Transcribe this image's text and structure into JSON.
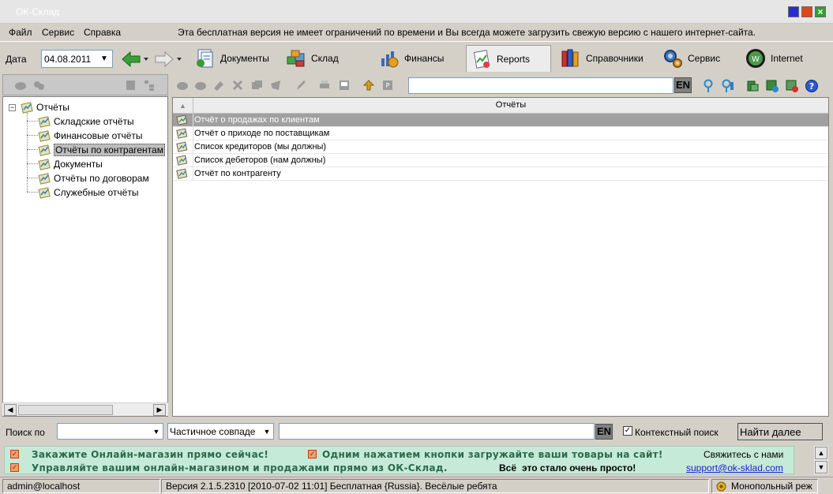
{
  "window": {
    "title": "ОК-Склад"
  },
  "menu": {
    "items": [
      "Файл",
      "Сервис",
      "Справка"
    ],
    "promo": "Эта бесплатная версия не имеет ограничений по времени и Вы всегда можете загрузить свежую версию с нашего интернет-сайта."
  },
  "nav": {
    "date_label": "Дата",
    "date_value": "04.08.2011",
    "tabs": [
      {
        "label": "Документы",
        "icon": "documents-icon"
      },
      {
        "label": "Склад",
        "icon": "warehouse-icon"
      },
      {
        "label": "Финансы",
        "icon": "finance-icon"
      },
      {
        "label": "Reports",
        "icon": "reports-icon"
      },
      {
        "label": "Справочники",
        "icon": "references-icon"
      },
      {
        "label": "Сервис",
        "icon": "service-icon"
      },
      {
        "label": "Internet",
        "icon": "internet-icon"
      }
    ]
  },
  "tree": {
    "root": "Отчёты",
    "children": [
      "Складские отчёты",
      "Финансовые отчёты",
      "Отчёты по контрагентам",
      "Документы",
      "Отчёты по договорам",
      "Служебные отчёты"
    ]
  },
  "grid": {
    "column": "Отчёты",
    "rows": [
      "Отчёт о продажах по клиентам",
      "Отчёт о приходе по поставщикам",
      "Список кредиторов (мы должны)",
      "Список дебеторов (нам должны)",
      "Отчёт по контрагенту"
    ]
  },
  "lang_badge": "EN",
  "search": {
    "label": "Поиск по",
    "mode": "Частичное совпаде",
    "context_label": "Контекстный поиск",
    "find_next": "Найти далее"
  },
  "banner": {
    "line1_left": "Закажите Онлайн-магазин прямо сейчас!",
    "line1_mid": "Одним нажатием кнопки загружайте ваши товары на сайт!",
    "line2_left": "Управляйте вашим онлайн-магазином и продажами прямо из ОК-Склад.",
    "line2_mid_a": "Всё",
    "line2_mid_b": "это стало очень просто!",
    "contact": "Свяжитесь с нами",
    "email": "support@ok-sklad.com"
  },
  "status": {
    "user": "admin@localhost",
    "version": "Версия 2.1.5.2310 [2010-07-02 11:01] Бесплатная {Russia}.  Весёлые ребята",
    "mode": "Монопольный реж"
  },
  "colors": {
    "banner_bg": "#c6ead8",
    "banner_text": "#2a6a4a",
    "selection": "#a0a0a0"
  }
}
